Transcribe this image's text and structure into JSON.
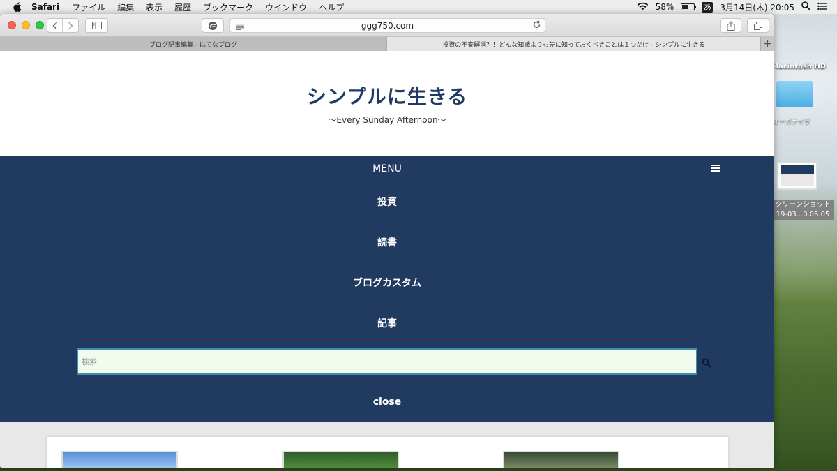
{
  "menubar": {
    "app_name": "Safari",
    "items": [
      "ファイル",
      "編集",
      "表示",
      "履歴",
      "ブックマーク",
      "ウインドウ",
      "ヘルプ"
    ],
    "battery_percent": "58%",
    "battery_level": 0.58,
    "input_method": "あ",
    "datetime": "3月14日(木)  20:05"
  },
  "browser": {
    "address": "ggg750.com",
    "tabs": [
      {
        "title": "ブログ記事編集 - はてなブログ",
        "active": false
      },
      {
        "title": "投資の不安解消？！どんな知識よりも先に知っておくべきことは１つだけ - シンプルに生きる",
        "active": true
      }
    ],
    "new_tab_label": "+"
  },
  "page": {
    "site_title": "シンプルに生きる",
    "site_subtitle": "〜Every Sunday Afternoon〜",
    "menu_label": "MENU",
    "nav_items": [
      "投資",
      "読書",
      "ブログカスタム",
      "記事"
    ],
    "search_placeholder": "検索",
    "close_label": "close"
  },
  "desktop": {
    "hd_label": "Macintosh HD",
    "folder_label": "オーガナイザ",
    "screenshot_label_line1": "クリーンショット",
    "screenshot_label_line2": "19-03...0.05.05"
  },
  "colors": {
    "nav_background": "#213a60",
    "title_color": "#1f3a63",
    "search_background": "#f1fcee",
    "search_border": "#3f8db3"
  }
}
